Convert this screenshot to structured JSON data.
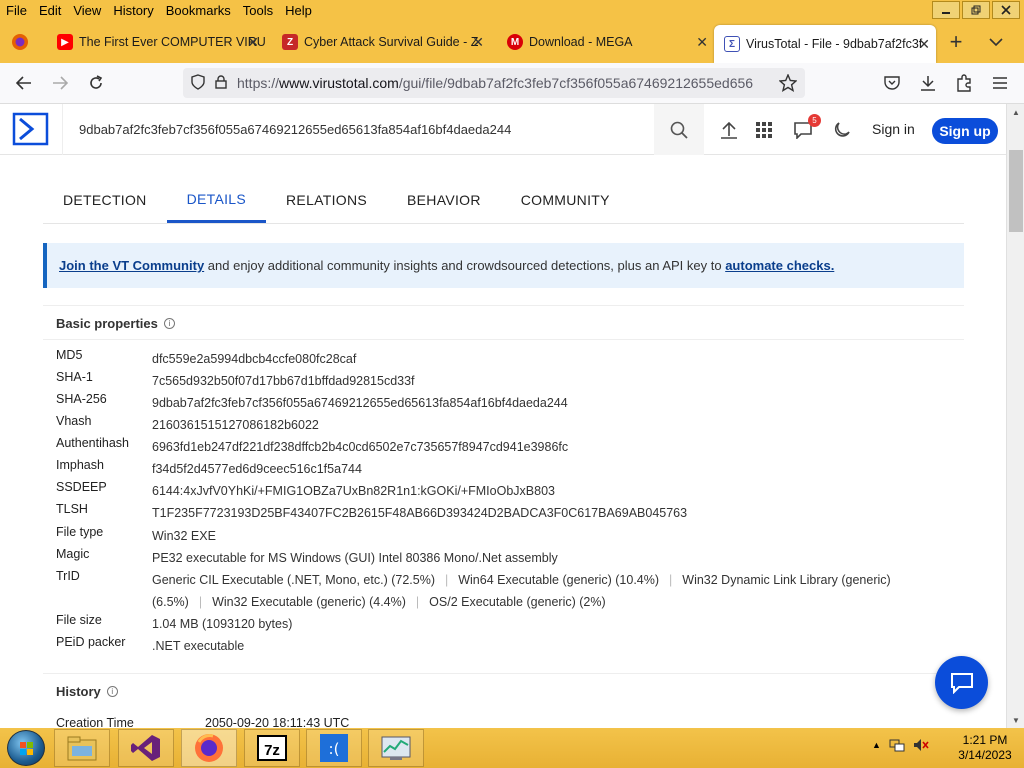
{
  "menubar": {
    "items": [
      "File",
      "Edit",
      "View",
      "History",
      "Bookmarks",
      "Tools",
      "Help"
    ],
    "accelerators": [
      "F",
      "E",
      "V",
      "H",
      "B",
      "T",
      "H"
    ]
  },
  "tabs": [
    {
      "title": "The First Ever COMPUTER VIRU",
      "icon": "youtube-icon"
    },
    {
      "title": "Cyber Attack Survival Guide - Z",
      "icon": "zlibrary-icon"
    },
    {
      "title": "Download - MEGA",
      "icon": "mega-icon"
    },
    {
      "title": "VirusTotal - File - 9dbab7af2fc3f",
      "icon": "virustotal-icon",
      "active": true
    }
  ],
  "urlbar": {
    "scheme": "https://",
    "host": "www.virustotal.com",
    "path": "/gui/file/9dbab7af2fc3feb7cf356f055a67469212655ed656"
  },
  "vt": {
    "search_value": "9dbab7af2fc3feb7cf356f055a67469212655ed65613fa854af16bf4daeda244",
    "notification_count": "5",
    "sign_in": "Sign in",
    "sign_up": "Sign up"
  },
  "vtabs": [
    "DETECTION",
    "DETAILS",
    "RELATIONS",
    "BEHAVIOR",
    "COMMUNITY"
  ],
  "banner": {
    "link1": "Join the VT Community",
    "middle": " and enjoy additional community insights and crowdsourced detections, plus an API key to ",
    "link2": "automate checks."
  },
  "basic": {
    "title": "Basic properties",
    "rows": [
      {
        "k": "MD5",
        "v": "dfc559e2a5994dbcb4ccfe080fc28caf"
      },
      {
        "k": "SHA-1",
        "v": "7c565d932b50f07d17bb67d1bffdad92815cd33f"
      },
      {
        "k": "SHA-256",
        "v": "9dbab7af2fc3feb7cf356f055a67469212655ed65613fa854af16bf4daeda244"
      },
      {
        "k": "Vhash",
        "v": "2160361515127086182b6022"
      },
      {
        "k": "Authentihash",
        "v": "6963fd1eb247df221df238dffcb2b4c0cd6502e7c735657f8947cd941e3986fc"
      },
      {
        "k": "Imphash",
        "v": "f34d5f2d4577ed6d9ceec516c1f5a744"
      },
      {
        "k": "SSDEEP",
        "v": "6144:4xJvfV0YhKi/+FMIG1OBZa7UxBn82R1n1:kGOKi/+FMIoObJxB803"
      },
      {
        "k": "TLSH",
        "v": "T1F235F7723193D25BF43407FC2B2615F48AB66D393424D2BADCA3F0C617BA69AB045763"
      },
      {
        "k": "File type",
        "v": "Win32 EXE"
      },
      {
        "k": "Magic",
        "v": "PE32 executable for MS Windows (GUI) Intel 80386 Mono/.Net assembly"
      },
      {
        "k": "File size",
        "v": "1.04 MB (1093120 bytes)"
      },
      {
        "k": "PEiD packer",
        "v": ".NET executable"
      }
    ],
    "trid_label": "TrID",
    "trid": [
      "Generic CIL Executable (.NET, Mono, etc.) (72.5%)",
      "Win64 Executable (generic) (10.4%)",
      "Win32 Dynamic Link Library (generic) (6.5%)",
      "Win32 Executable (generic) (4.4%)",
      "OS/2 Executable (generic) (2%)"
    ]
  },
  "history": {
    "title": "History",
    "creation_label": "Creation Time",
    "creation_value": "2050-09-20 18:11:43 UTC"
  },
  "taskbar": {
    "apps": [
      "file-explorer-icon",
      "visual-studio-icon",
      "firefox-icon",
      "7zip-icon",
      "bsod-icon",
      "resource-monitor-icon"
    ],
    "time": "1:21 PM",
    "date": "3/14/2023"
  },
  "colors": {
    "firefox_chrome": "#f5c246",
    "vt_blue": "#0b4dda",
    "tab_active": "#1a56c8"
  }
}
